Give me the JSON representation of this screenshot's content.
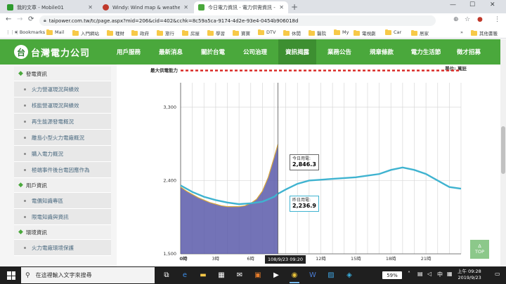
{
  "browser": {
    "tabs": [
      {
        "title": "我的文章 - Mobile01",
        "fav_color": "#2e9b2e"
      },
      {
        "title": "Windy: Wind map & weather fo",
        "fav_color": "#c0392b"
      },
      {
        "title": "今日電力資訊 - 電力供需資訊 - 資",
        "fav_color": "#4aa83c"
      }
    ],
    "url": "taipower.com.tw/tc/page.aspx?mid=206&cid=402&cchk=8c59a5ca-9174-4d2e-93e4-0454b906018d",
    "bookmarks": [
      "Bookmarks",
      "Mail",
      "入門網站",
      "理財",
      "政府",
      "旅行",
      "房屋",
      "學習",
      "寶寶",
      "DTV",
      "休閒",
      "醫院",
      "My",
      "電視劇",
      "Car",
      "居家",
      "其他書籤"
    ]
  },
  "site": {
    "logo_mark": "台",
    "logo_text": "台灣電力公司",
    "nav": [
      "用戶服務",
      "最新消息",
      "關於台電",
      "公司治理",
      "資訊揭露",
      "業務公告",
      "規章條款",
      "電力生活節",
      "徵才招募"
    ],
    "active_nav": 4
  },
  "sidebar": {
    "groups": [
      {
        "label": "發電資訊",
        "items": [
          "火力營運現況與績效",
          "核能營運現況與績效",
          "再生能源發電概況",
          "離島小型火力電廠概況",
          "購入電力概況",
          "極端事件後台電因應作為"
        ]
      },
      {
        "label": "用戶資訊",
        "items": [
          "電價知識專區",
          "限電知識與資訊"
        ]
      },
      {
        "label": "環境資訊",
        "items": [
          "火力電廠環境保護"
        ]
      }
    ]
  },
  "chart": {
    "unit_note": "單位: 萬瓩",
    "max_label": "最大供電能力",
    "today_tooltip": {
      "label": "今日用電:",
      "value": "2,846.3"
    },
    "yesterday_tooltip": {
      "label": "昨日用電:",
      "value": "2,236.9"
    },
    "time_badge": "108/9/23 09:20",
    "top_button": {
      "arrow": "∆",
      "label": "TOP"
    }
  },
  "chart_data": {
    "type": "line",
    "title": "",
    "xlabel": "",
    "ylabel": "",
    "ylim": [
      1500,
      3600
    ],
    "xlim": [
      0,
      24
    ],
    "y_ticks": [
      1500,
      2400,
      3300
    ],
    "y_tick_labels": [
      "1,500",
      "2,400",
      "3,300"
    ],
    "x_ticks": [
      0,
      3,
      6,
      9,
      12,
      15,
      18,
      21
    ],
    "x_tick_labels": [
      "0時",
      "3時",
      "6時",
      "9時",
      "12時",
      "15時",
      "18時",
      "21時"
    ],
    "max_capacity": 3750,
    "series": [
      {
        "color": "#5a5aaa",
        "style": "area",
        "x": [
          0,
          0.5,
          1,
          1.5,
          2,
          2.5,
          3,
          3.5,
          4,
          4.5,
          5,
          5.5,
          6,
          6.5,
          7,
          7.5,
          8,
          8.33
        ],
        "values": [
          2320,
          2270,
          2230,
          2190,
          2160,
          2130,
          2110,
          2090,
          2080,
          2080,
          2080,
          2090,
          2120,
          2170,
          2270,
          2440,
          2680,
          2846
        ]
      },
      {
        "color": "#3fb3d0",
        "style": "line",
        "x": [
          0,
          1,
          2,
          3,
          4,
          5,
          6,
          7,
          8,
          8.33,
          9,
          10,
          11,
          12,
          13,
          14,
          15,
          16,
          17,
          18,
          19,
          20,
          21,
          22,
          23,
          24
        ],
        "values": [
          2340,
          2260,
          2200,
          2160,
          2130,
          2110,
          2120,
          2140,
          2200,
          2237,
          2290,
          2360,
          2400,
          2410,
          2420,
          2430,
          2440,
          2460,
          2480,
          2530,
          2560,
          2530,
          2480,
          2400,
          2320,
          2300
        ]
      }
    ]
  },
  "taskbar": {
    "search_placeholder": "在這裡輸入文字來搜尋",
    "battery": "59%",
    "time": "上午 09:28",
    "date": "2019/9/23"
  }
}
